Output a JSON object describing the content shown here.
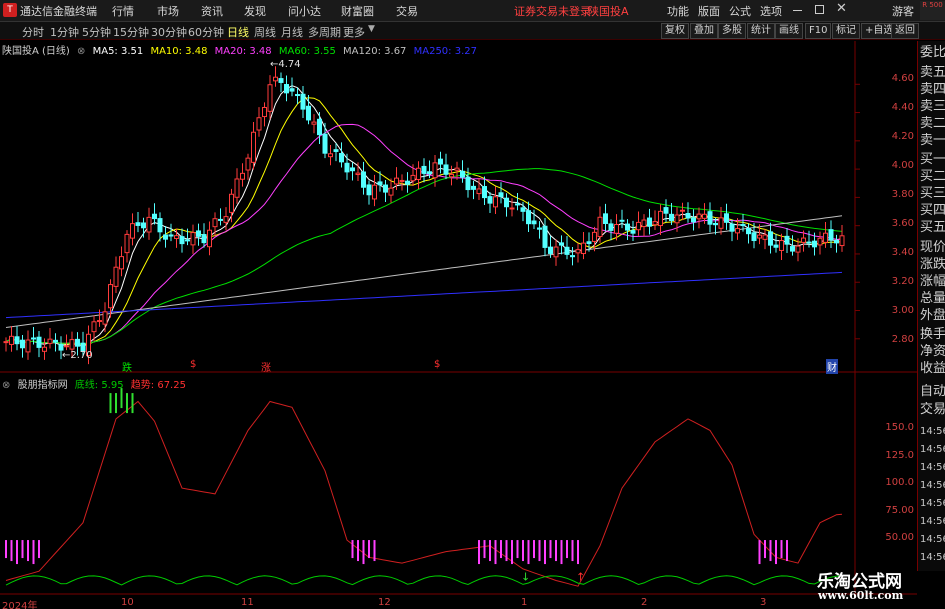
{
  "titlebar": {
    "app_name": "通达信金融终端",
    "menus": [
      "行情",
      "市场",
      "资讯",
      "发现",
      "问小达",
      "财富圈",
      "交易"
    ],
    "warning": "证券交易未登录",
    "stock": "陕国投A",
    "right_menus": [
      "功能",
      "版面",
      "公式",
      "选项"
    ],
    "guest": "游客",
    "rs_badge": "R 500"
  },
  "periods": [
    "分时",
    "1分钟",
    "5分钟",
    "15分钟",
    "30分钟",
    "60分钟",
    "日线",
    "周线",
    "月线",
    "多周期",
    "更多"
  ],
  "active_period": "日线",
  "toolbar_right": [
    "复权",
    "叠加",
    "多股",
    "统计",
    "画线",
    "F10",
    "标记",
    "+自选",
    "返回"
  ],
  "price_legend": {
    "name": "陕国投A (日线)",
    "ma5": "MA5: 3.51",
    "ma10": "MA10: 3.48",
    "ma20": "MA20: 3.48",
    "ma60": "MA60: 3.55",
    "ma120": "MA120: 3.67",
    "ma250": "MA250: 3.27"
  },
  "indicator_legend": {
    "name": "股朋指标网",
    "line1": "底线: 5.95",
    "line2": "趋势: 67.25"
  },
  "price_axis": [
    "4.60",
    "4.40",
    "4.20",
    "4.00",
    "3.80",
    "3.60",
    "3.40",
    "3.20",
    "3.00",
    "2.80"
  ],
  "indicator_axis": [
    "150.0",
    "125.0",
    "100.0",
    "75.00",
    "50.00"
  ],
  "x_axis": [
    "2024年",
    "10",
    "11",
    "12",
    "1",
    "2",
    "3"
  ],
  "annotations": {
    "high": "4.74",
    "low": "2.70",
    "markers": [
      "跌",
      "$",
      "涨",
      "$",
      "财"
    ]
  },
  "right_panel": [
    "委比",
    "卖五",
    "卖四",
    "卖三",
    "卖二",
    "卖一",
    "买一",
    "买二",
    "买三",
    "买四",
    "买五",
    "现价",
    "涨跌",
    "涨幅",
    "总量",
    "外盘",
    "换手",
    "净资",
    "收益",
    "自动",
    "交易"
  ],
  "right_times": [
    "14:56",
    "14:56",
    "14:56",
    "14:56",
    "14:56",
    "14:56",
    "14:56",
    "14:56",
    "14:56",
    "14:56"
  ],
  "watermark": {
    "line1": "乐淘公式网",
    "line2": "www.60lt.com"
  },
  "colors": {
    "up": "#ff3c3c",
    "down": "#54ffff",
    "ma5": "#ffffff",
    "ma10": "#ffff00",
    "ma20": "#ff40ff",
    "ma60": "#00e000",
    "ma120": "#c0c0c0",
    "ma250": "#3030ff",
    "trend": "#d02020",
    "base": "#00cc00"
  },
  "chart_data": {
    "type": "candlestick",
    "price_range": [
      2.65,
      4.8
    ],
    "indicator_range": [
      0,
      175
    ],
    "count": 153
  }
}
